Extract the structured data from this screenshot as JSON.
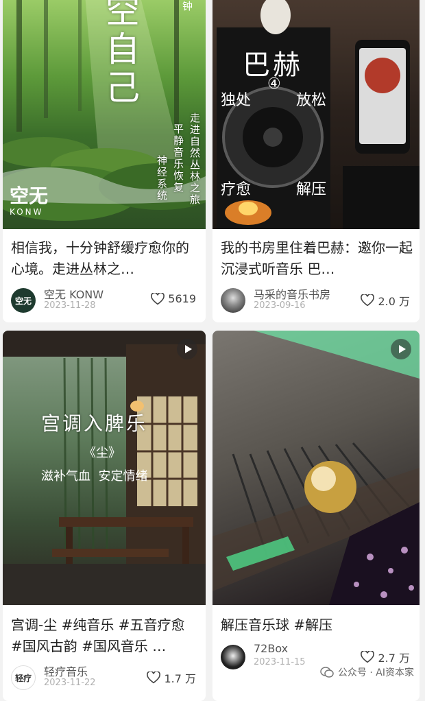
{
  "cards": [
    {
      "title": "相信我，十分钟舒缓疗愈你的心境。走进丛林之…",
      "author": "空无 KONW",
      "date": "2023-11-28",
      "likes": "5619",
      "thumb": {
        "big_text": "空自己",
        "corner_text": "钟",
        "logo": "空无",
        "logo_sub": "KONW",
        "lines": [
          "走进自然丛林之旅",
          "平静音乐恢复",
          "神经系统"
        ]
      },
      "avatar_text": "空无"
    },
    {
      "title": "我的书房里住着巴赫：邀你一起沉浸式听音乐 巴…",
      "author": "马采的音乐书房",
      "date": "2023-09-16",
      "likes": "2.0 万",
      "thumb": {
        "big_text": "巴赫",
        "circle_num": "④",
        "left_top": "独处",
        "right_top": "放松",
        "left_bottom": "疗愈",
        "right_bottom": "解压"
      }
    },
    {
      "title": "宫调-尘 #纯音乐 #五音疗愈 #国风古韵 #国风音乐 …",
      "author": "轻疗音乐",
      "date": "2023-11-22",
      "likes": "1.7 万",
      "thumb": {
        "headline": "宫调入脾乐",
        "sub": "《尘》",
        "line": "滋补气血  安定情绪"
      },
      "avatar_text": "轻疗"
    },
    {
      "title": "解压音乐球 #解压",
      "author": "72Box",
      "date": "2023-11-15",
      "likes": "2.7 万"
    }
  ],
  "watermark": "公众号 · AI资本家",
  "colors": {
    "like": "#444444",
    "date": "#b0b0b0",
    "forest": "#3e7a2a"
  }
}
